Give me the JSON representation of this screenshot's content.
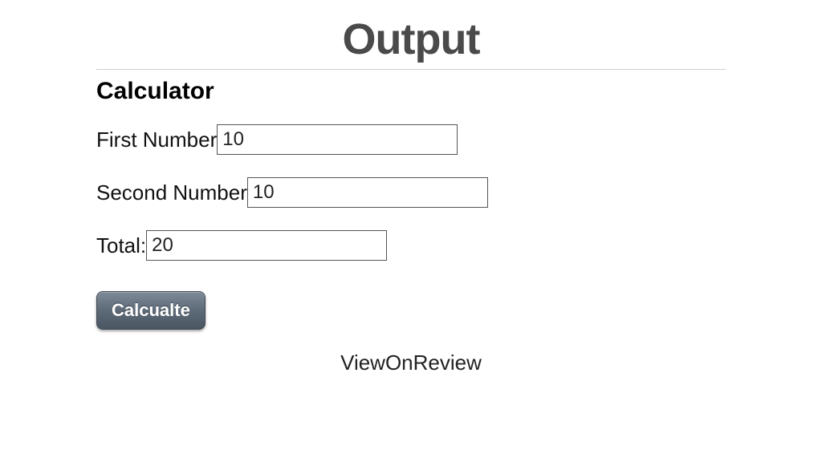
{
  "header": {
    "title": "Output"
  },
  "section": {
    "heading": "Calculator"
  },
  "form": {
    "first_label": "First Number",
    "first_value": "10",
    "second_label": "Second Number",
    "second_value": "10",
    "total_label": "Total:",
    "total_value": "20",
    "calculate_label": "Calcualte"
  },
  "footer": {
    "text": "ViewOnReview"
  }
}
